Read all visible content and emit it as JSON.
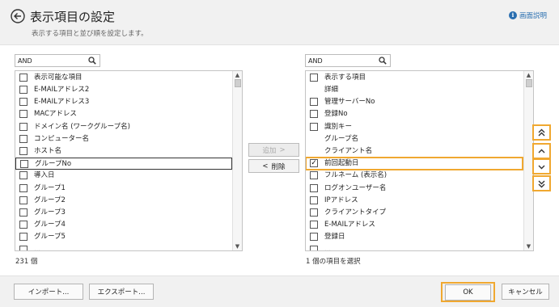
{
  "header": {
    "title": "表示項目の設定",
    "subtitle": "表示する項目と並び順を設定します。",
    "help_label": "画面説明"
  },
  "left": {
    "search_value": "AND",
    "header_label": "表示可能な項目",
    "items": [
      "E-MAILアドレス2",
      "E-MAILアドレス3",
      "MACアドレス",
      "ドメイン名 (ワークグループ名)",
      "コンピューター名",
      "ホスト名",
      "グループNo",
      "導入日",
      "グループ1",
      "グループ2",
      "グループ3",
      "グループ4",
      "グループ5",
      "..."
    ],
    "count": "231 個"
  },
  "right": {
    "search_value": "AND",
    "header_label": "表示する項目",
    "items": [
      {
        "label": "詳細",
        "checkbox": false
      },
      {
        "label": "管理サーバーNo",
        "checkbox": true,
        "checked": false
      },
      {
        "label": "登録No",
        "checkbox": true,
        "checked": false
      },
      {
        "label": "識別キー",
        "checkbox": true,
        "checked": false
      },
      {
        "label": "グループ名",
        "checkbox": false
      },
      {
        "label": "クライアント名",
        "checkbox": false
      },
      {
        "label": "前回起動日",
        "checkbox": true,
        "checked": true
      },
      {
        "label": "フルネーム (表示名)",
        "checkbox": true,
        "checked": false
      },
      {
        "label": "ログオンユーザー名",
        "checkbox": true,
        "checked": false
      },
      {
        "label": "IPアドレス",
        "checkbox": true,
        "checked": false
      },
      {
        "label": "クライアントタイプ",
        "checkbox": true,
        "checked": false
      },
      {
        "label": "E-MAILアドレス",
        "checkbox": true,
        "checked": false
      },
      {
        "label": "登録日",
        "checkbox": true,
        "checked": false
      },
      {
        "label": "...",
        "checkbox": true,
        "checked": false
      }
    ],
    "count": "1 個の項目を選択"
  },
  "middle": {
    "add_label": "追加",
    "remove_label": "削除"
  },
  "footer": {
    "import_label": "インポート...",
    "export_label": "エクスポート...",
    "ok_label": "OK",
    "cancel_label": "キャンセル"
  },
  "colors": {
    "highlight": "#f0a830",
    "link": "#2a6fb0"
  }
}
